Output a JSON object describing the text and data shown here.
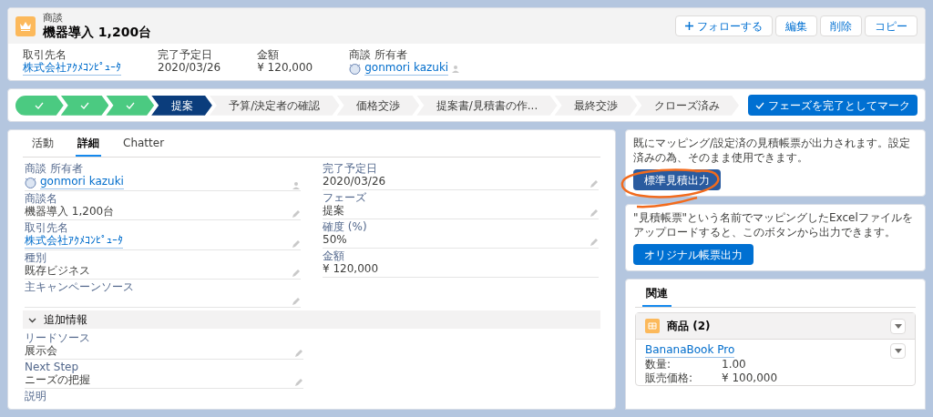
{
  "header": {
    "object_label": "商談",
    "title": "機器導入 1,200台",
    "actions": [
      {
        "label": "フォローする",
        "kind": "follow"
      },
      {
        "label": "編集",
        "kind": "plain"
      },
      {
        "label": "削除",
        "kind": "plain"
      },
      {
        "label": "コピー",
        "kind": "plain"
      }
    ],
    "fields": [
      {
        "label": "取引先名",
        "value": "株式会社ｱｸﾒｺﾝﾋﾟｭｰﾀ",
        "kind": "link"
      },
      {
        "label": "完了予定日",
        "value": "2020/03/26",
        "kind": "text"
      },
      {
        "label": "金額",
        "value": "¥ 120,000",
        "kind": "text"
      },
      {
        "label": "商談 所有者",
        "value": "gonmori kazuki",
        "kind": "user"
      }
    ]
  },
  "path": {
    "stages": [
      {
        "kind": "complete"
      },
      {
        "kind": "complete"
      },
      {
        "kind": "complete"
      },
      {
        "kind": "current",
        "label": "提案"
      },
      {
        "kind": "incomplete",
        "label": "予算/決定者の確認"
      },
      {
        "kind": "incomplete",
        "label": "価格交渉"
      },
      {
        "kind": "incomplete",
        "label": "提案書/見積書の作..."
      },
      {
        "kind": "incomplete",
        "label": "最終交渉"
      },
      {
        "kind": "incomplete",
        "label": "クローズ済み"
      }
    ],
    "mark_button": "フェーズを完了としてマーク"
  },
  "detail": {
    "tabs": [
      {
        "label": "活動",
        "selected": false
      },
      {
        "label": "詳細",
        "selected": true
      },
      {
        "label": "Chatter",
        "selected": false
      }
    ],
    "left_fields": [
      {
        "label": "商談 所有者",
        "value": "gonmori kazuki",
        "kind": "user",
        "editable": false
      },
      {
        "label": "商談名",
        "value": "機器導入 1,200台",
        "kind": "text",
        "editable": true
      },
      {
        "label": "取引先名",
        "value": "株式会社ｱｸﾒｺﾝﾋﾟｭｰﾀ",
        "kind": "link",
        "editable": true
      },
      {
        "label": "種別",
        "value": "既存ビジネス",
        "kind": "text",
        "editable": true
      },
      {
        "label": "主キャンペーンソース",
        "editable": true
      }
    ],
    "right_fields": [
      {
        "label": "完了予定日",
        "value": "2020/03/26",
        "kind": "text",
        "editable": true
      },
      {
        "label": "フェーズ",
        "value": "提案",
        "kind": "text",
        "editable": true
      },
      {
        "label": "確度 (%)",
        "value": "50%",
        "kind": "text",
        "editable": true
      },
      {
        "label": "金額",
        "value": "¥ 120,000",
        "kind": "text",
        "editable": false
      }
    ],
    "section": {
      "title": "追加情報",
      "expanded": true,
      "fields": [
        {
          "label": "リードソース",
          "value": "展示会",
          "kind": "text",
          "editable": true
        },
        {
          "label": "Next Step",
          "value": "ニーズの把握",
          "kind": "text",
          "editable": true
        },
        {
          "label": "説明",
          "editable": false
        }
      ]
    }
  },
  "standard_quote": {
    "text": "既にマッピング/設定済の見積帳票が出力されます。設定済みの為、そのまま使用できます。",
    "button": "標準見積出力"
  },
  "original_quote": {
    "text": "\"見積帳票\"という名前でマッピングしたExcelファイルをアップロードすると、このボタンから出力できます。",
    "button": "オリジナル帳票出力"
  },
  "related": {
    "tabs": [
      {
        "label": "関連",
        "selected": true
      }
    ],
    "list": {
      "title": "商品 (2)",
      "items": [
        {
          "name": "BananaBook Pro",
          "fields": [
            {
              "label": "数量:",
              "value": "1.00"
            },
            {
              "label": "販売価格:",
              "value": "¥ 100,000"
            }
          ]
        }
      ]
    }
  }
}
